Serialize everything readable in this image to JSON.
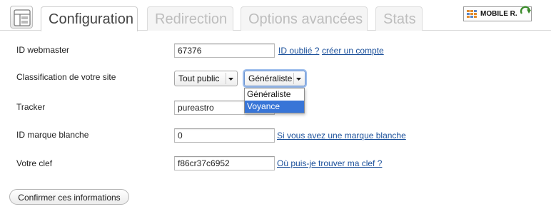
{
  "tabs": [
    {
      "label": "Configuration",
      "active": true
    },
    {
      "label": "Redirection",
      "active": false
    },
    {
      "label": "Options avancées",
      "active": false
    },
    {
      "label": "Stats",
      "active": false
    }
  ],
  "logo": {
    "text": "MOBILE R.",
    "icon": "grid-logo-icon"
  },
  "form": {
    "webmaster": {
      "label": "ID webmaster",
      "value": "67376",
      "link_forgot": "ID oublié ?",
      "link_create": "créer un compte"
    },
    "classification": {
      "label": "Classification de votre site",
      "select1": "Tout public",
      "select2": "Généraliste",
      "options": [
        "Généraliste",
        "Voyance"
      ],
      "highlighted": "Voyance"
    },
    "tracker": {
      "label": "Tracker",
      "value": "pureastro"
    },
    "marque": {
      "label": "ID marque blanche",
      "value": "0",
      "link": "Si vous avez une marque blanche"
    },
    "clef": {
      "label": "Votre clef",
      "value": "f86cr37c6952",
      "link": "Où puis-je trouver ma clef ?"
    },
    "submit_label": "Confirmer ces informations"
  },
  "colors": {
    "link": "#1a4f9a",
    "highlight": "#3875d7"
  }
}
